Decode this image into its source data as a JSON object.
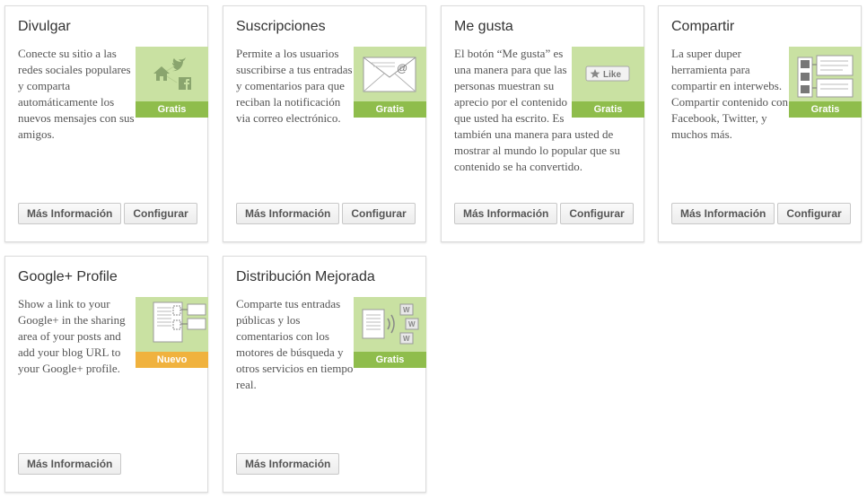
{
  "cards": [
    {
      "title": "Divulgar",
      "description": "Conecte su sitio a las redes sociales populares y comparta automáticamente los nuevos mensajes con sus amigos.",
      "badge": "Gratis",
      "icon": "share-network-icon",
      "more_label": "Más Información",
      "config_label": "Configurar"
    },
    {
      "title": "Suscripciones",
      "description": "Permite a los usuarios suscribirse a tus entradas y comentarios para que reciban la notificación via correo electrónico.",
      "badge": "Gratis",
      "icon": "envelope-icon",
      "more_label": "Más Información",
      "config_label": "Configurar"
    },
    {
      "title": "Me gusta",
      "description": "El botón “Me gusta” es una manera para que las personas muestran su aprecio por el contenido que usted ha escrito. Es también una manera para usted de mostrar al mundo lo popular que su contenido se ha convertido.",
      "badge": "Gratis",
      "icon": "like-button-icon",
      "icon_text": "Like",
      "more_label": "Más Información",
      "config_label": "Configurar"
    },
    {
      "title": "Compartir",
      "description": "La super duper herramienta para compartir en interwebs. Compartir contenido con Facebook, Twitter, y muchos más.",
      "badge": "Gratis",
      "icon": "sharing-buttons-icon",
      "more_label": "Más Información",
      "config_label": "Configurar"
    },
    {
      "title": "Google+ Profile",
      "description": "Show a link to your Google+ in the sharing area of your posts and add your blog URL to your Google+ profile.",
      "badge": "Nuevo",
      "icon": "profile-link-icon",
      "more_label": "Más Información"
    },
    {
      "title": "Distribución Mejorada",
      "description": "Comparte tus entradas públicas y los comentarios con los motores de búsqueda y otros servicios en tiempo real.",
      "badge": "Gratis",
      "icon": "broadcast-icon",
      "more_label": "Más Información"
    }
  ],
  "colors": {
    "thumb_bg": "#c9e1a2",
    "badge_free": "#8fbd4c",
    "badge_new": "#f0b23e"
  }
}
